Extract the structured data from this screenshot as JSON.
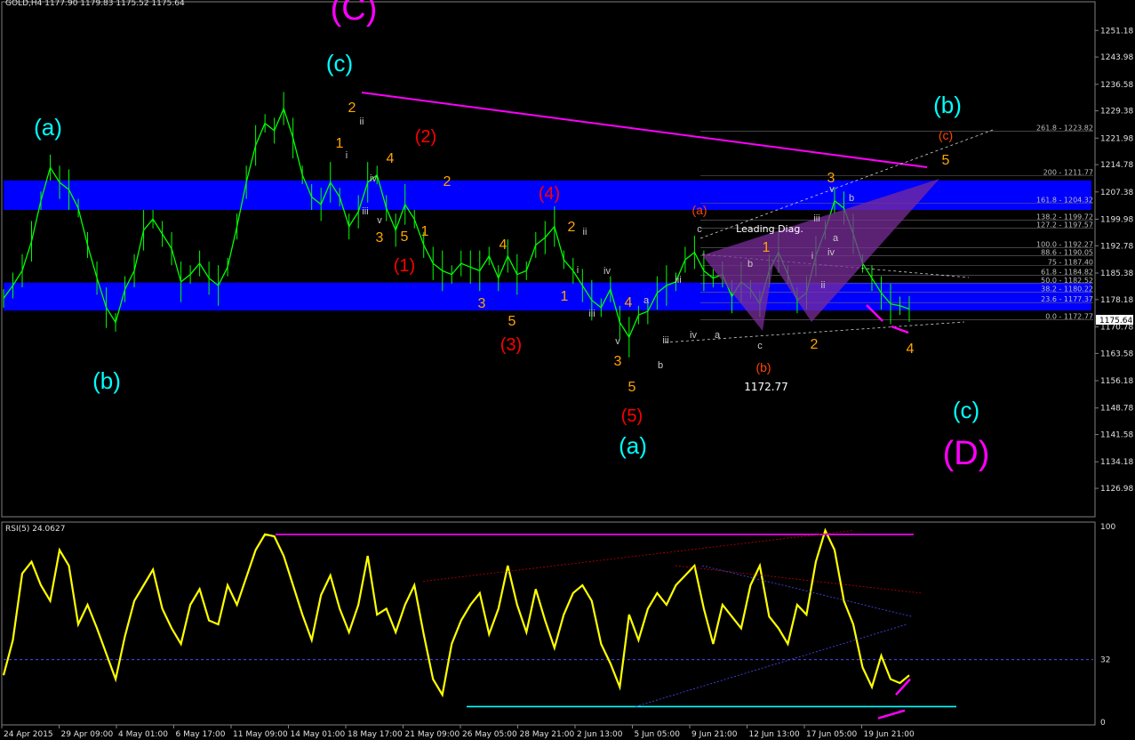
{
  "window": {
    "symbol_header": "GOLD,H4  1177.90 1179.83 1175.52 1175.64",
    "rsi_header": "RSI(5) 24.0627",
    "current_price": "1175.64",
    "annotation_price": "1172.77",
    "leading_diag": "Leading Diag."
  },
  "colors": {
    "background": "#000000",
    "candles": "#00ff00",
    "zones": "#0000ff",
    "rsi": "#ffff00",
    "trendline_magenta": "#ff00ff",
    "cyan": "#00ffff",
    "orange": "#ffa500",
    "red": "#ff0000"
  },
  "chart_data": [
    {
      "type": "line",
      "title": "GOLD,H4",
      "ylim": [
        1120,
        1258
      ],
      "ticks_y": [
        "1251.18",
        "1243.98",
        "1236.58",
        "1229.38",
        "1221.98",
        "1214.78",
        "1207.38",
        "1199.98",
        "1192.78",
        "1185.38",
        "1178.18",
        "1170.78",
        "1163.58",
        "1156.18",
        "1148.78",
        "1141.58",
        "1134.18",
        "1126.98"
      ],
      "x_labels": [
        "24 Apr 2015",
        "29 Apr 09:00",
        "4 May 01:00",
        "6 May 17:00",
        "11 May 09:00",
        "14 May 01:00",
        "18 May 17:00",
        "21 May 09:00",
        "26 May 05:00",
        "28 May 21:00",
        "2 Jun 13:00",
        "5 Jun 05:00",
        "9 Jun 21:00",
        "12 Jun 13:00",
        "17 Jun 05:00",
        "19 Jun 21:00"
      ],
      "series": [
        {
          "values": [
            1178.5,
            1182,
            1186,
            1194,
            1205,
            1214,
            1210,
            1208,
            1203,
            1193,
            1184,
            1176,
            1172,
            1181,
            1186,
            1197,
            1200,
            1196,
            1192,
            1183,
            1185,
            1188,
            1184,
            1182,
            1187,
            1198,
            1210,
            1220,
            1226,
            1224,
            1230,
            1222,
            1212,
            1206,
            1204,
            1210,
            1206,
            1198,
            1202,
            1210,
            1212,
            1203,
            1197,
            1204,
            1200,
            1193,
            1188,
            1186,
            1185,
            1188,
            1187,
            1186,
            1190,
            1184,
            1190,
            1185,
            1186,
            1193,
            1195,
            1198,
            1189,
            1186,
            1182,
            1178,
            1176,
            1181,
            1172,
            1168,
            1174,
            1175,
            1180,
            1182,
            1183,
            1189,
            1191,
            1186,
            1184,
            1185,
            1179,
            1183,
            1181,
            1177,
            1186,
            1191,
            1185,
            1178,
            1180,
            1190,
            1197,
            1205,
            1203,
            1196,
            1188,
            1184,
            1180,
            1177,
            1176.5,
            1175.64
          ]
        }
      ],
      "zones": [
        [
          1210.5,
          1202.5
        ],
        [
          1182.8,
          1175.2
        ]
      ],
      "fibonacci": [
        {
          "label": "261.8 - 1223.82",
          "value": 1223.82
        },
        {
          "label": "200 - 1211.77",
          "value": 1211.77
        },
        {
          "label": "161.8 - 1204.32",
          "value": 1204.32
        },
        {
          "label": "138.2 - 1199.72",
          "value": 1199.72
        },
        {
          "label": "127.2 - 1197.57",
          "value": 1197.57
        },
        {
          "label": "100.0 - 1192.27",
          "value": 1192.27
        },
        {
          "label": "88.6 - 1190.05",
          "value": 1190.05
        },
        {
          "label": "75 - 1187.40",
          "value": 1187.4
        },
        {
          "label": "61.8 - 1184.82",
          "value": 1184.82
        },
        {
          "label": "50.0 - 1182.52",
          "value": 1182.52
        },
        {
          "label": "38.2 - 1180.22",
          "value": 1180.22
        },
        {
          "label": "23.6 - 1177.37",
          "value": 1177.37
        },
        {
          "label": "0.0 - 1172.77",
          "value": 1172.77
        }
      ]
    },
    {
      "type": "line",
      "title": "RSI(5) 24.0627",
      "ylim": [
        0,
        100
      ],
      "ticks_y": [
        "100",
        "32",
        "0"
      ],
      "series": [
        {
          "name": "RSI(5)",
          "values": [
            24,
            42,
            76,
            82,
            70,
            62,
            88,
            80,
            50,
            60,
            48,
            35,
            22,
            44,
            62,
            70,
            78,
            58,
            48,
            40,
            60,
            68,
            52,
            50,
            70,
            60,
            74,
            88,
            96,
            95,
            85,
            70,
            55,
            42,
            65,
            75,
            58,
            46,
            60,
            85,
            55,
            58,
            46,
            60,
            70,
            45,
            22,
            14,
            40,
            52,
            60,
            66,
            45,
            58,
            80,
            60,
            46,
            68,
            52,
            38,
            55,
            66,
            70,
            62,
            40,
            30,
            18,
            55,
            42,
            58,
            66,
            60,
            70,
            75,
            80,
            58,
            40,
            60,
            54,
            48,
            70,
            80,
            54,
            48,
            40,
            60,
            55,
            82,
            98,
            88,
            62,
            50,
            28,
            18,
            34,
            22,
            20,
            24
          ]
        }
      ]
    }
  ],
  "wave_labels": [
    {
      "text": "(C)",
      "color": "#ff00ff"
    },
    {
      "text": "(c)",
      "color": "#00ffff"
    },
    {
      "text": "(a)",
      "color": "#00ffff"
    },
    {
      "text": "(b)",
      "color": "#00ffff"
    },
    {
      "text": "(a)",
      "color": "#00ffff"
    },
    {
      "text": "(b)",
      "color": "#00ffff"
    },
    {
      "text": "(c)",
      "color": "#00ffff"
    },
    {
      "text": "(D)",
      "color": "#ff00ff"
    },
    {
      "text": "(2)",
      "color": "#ff0000"
    },
    {
      "text": "(4)",
      "color": "#ff0000"
    },
    {
      "text": "(1)",
      "color": "#ff0000"
    },
    {
      "text": "(3)",
      "color": "#ff0000"
    },
    {
      "text": "(5)",
      "color": "#ff0000"
    },
    {
      "text": "(a)",
      "color": "#ff4500"
    },
    {
      "text": "(b)",
      "color": "#ff4500"
    },
    {
      "text": "(c)",
      "color": "#ff4500"
    },
    {
      "text": "2",
      "color": "#ffa500"
    },
    {
      "text": "1",
      "color": "#ffa500"
    },
    {
      "text": "4",
      "color": "#ffa500"
    },
    {
      "text": "3",
      "color": "#ffa500"
    },
    {
      "text": "5",
      "color": "#ffa500"
    },
    {
      "text": "1",
      "color": "#ffa500"
    },
    {
      "text": "2",
      "color": "#ffa500"
    },
    {
      "text": "4",
      "color": "#ffa500"
    },
    {
      "text": "3",
      "color": "#ffa500"
    },
    {
      "text": "5",
      "color": "#ffa500"
    },
    {
      "text": "2",
      "color": "#ffa500"
    },
    {
      "text": "1",
      "color": "#ffa500"
    },
    {
      "text": "4",
      "color": "#ffa500"
    },
    {
      "text": "3",
      "color": "#ffa500"
    },
    {
      "text": "5",
      "color": "#ffa500"
    },
    {
      "text": "1",
      "color": "#ffa500"
    },
    {
      "text": "2",
      "color": "#ffa500"
    },
    {
      "text": "3",
      "color": "#ffa500"
    },
    {
      "text": "4",
      "color": "#ffa500"
    },
    {
      "text": "5",
      "color": "#ffa500"
    }
  ],
  "minor_labels": [
    {
      "text": "ii",
      "color": "#c8c8c8"
    },
    {
      "text": "i",
      "color": "#c8c8c8"
    },
    {
      "text": "iv",
      "color": "#c8c8c8"
    },
    {
      "text": "iii",
      "color": "#c8c8c8"
    },
    {
      "text": "v",
      "color": "#c8c8c8"
    },
    {
      "text": "ii",
      "color": "#c8c8c8"
    },
    {
      "text": "i",
      "color": "#c8c8c8"
    },
    {
      "text": "iv",
      "color": "#c8c8c8"
    },
    {
      "text": "iii",
      "color": "#c8c8c8"
    },
    {
      "text": "v",
      "color": "#c8c8c8"
    },
    {
      "text": "a",
      "color": "#c8c8c8"
    },
    {
      "text": "b",
      "color": "#c8c8c8"
    },
    {
      "text": "c",
      "color": "#c8c8c8"
    },
    {
      "text": "iii",
      "color": "#c8c8c8"
    },
    {
      "text": "iv",
      "color": "#c8c8c8"
    },
    {
      "text": "a",
      "color": "#c8c8c8"
    },
    {
      "text": "b",
      "color": "#c8c8c8"
    },
    {
      "text": "c",
      "color": "#c8c8c8"
    },
    {
      "text": "iii",
      "color": "#c8c8c8"
    },
    {
      "text": "i",
      "color": "#c8c8c8"
    },
    {
      "text": "ii",
      "color": "#c8c8c8"
    },
    {
      "text": "iv",
      "color": "#c8c8c8"
    },
    {
      "text": "a",
      "color": "#c8c8c8"
    },
    {
      "text": "b",
      "color": "#c8c8c8"
    },
    {
      "text": "v",
      "color": "#c8c8c8"
    },
    {
      "text": "iii",
      "color": "#c8c8c8"
    }
  ]
}
